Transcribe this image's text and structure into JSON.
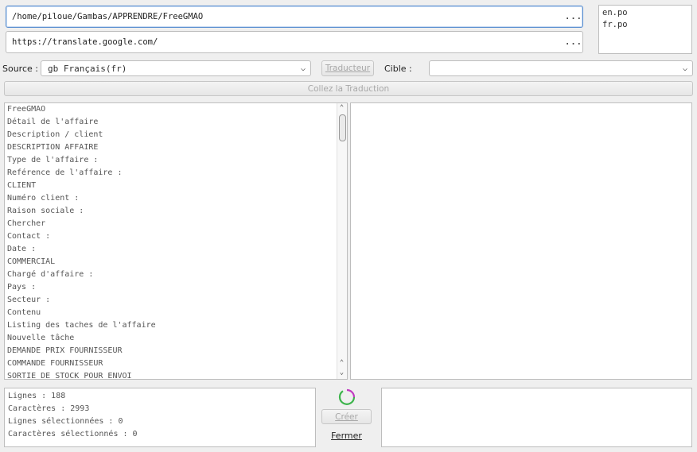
{
  "paths": {
    "project": "/home/piloue/Gambas/APPRENDRE/FreeGMAO",
    "url": "https://translate.google.com/",
    "browse": "..."
  },
  "languages": [
    "en.po",
    "fr.po"
  ],
  "toolbar": {
    "source_label": "Source :",
    "source_value": "gb Français(fr)",
    "translator_button": "Traducteur",
    "target_label": "Cible :",
    "target_value": ""
  },
  "paste_button": "Collez la Traduction",
  "source_lines": [
    "FreeGMAO",
    "Détail de l'affaire",
    "Description / client",
    "DESCRIPTION AFFAIRE",
    "Type de l'affaire :",
    "Reférence de l'affaire :",
    "CLIENT",
    "Numéro client :",
    "Raison sociale :",
    "Chercher",
    "Contact :",
    "Date :",
    "COMMERCIAL",
    "Chargé d'affaire :",
    "Pays :",
    "Secteur :",
    "Contenu",
    "Listing des taches de l'affaire",
    "Nouvelle tâche",
    "DEMANDE PRIX FOURNISSEUR",
    "COMMANDE FOURNISSEUR",
    "SORTIE DE STOCK POUR ENVOI"
  ],
  "stats": {
    "lines": "Lignes : 188",
    "chars": "Caractères : 2993",
    "sel_lines": "Lignes sélectionnées : 0",
    "sel_chars": "Caractères sélectionnés : 0"
  },
  "actions": {
    "create": "Créer",
    "close": "Fermer"
  },
  "colors": {
    "spinner_green": "#3cb44b",
    "spinner_magenta": "#c03cc0",
    "focus_border": "#5a8fd0"
  }
}
